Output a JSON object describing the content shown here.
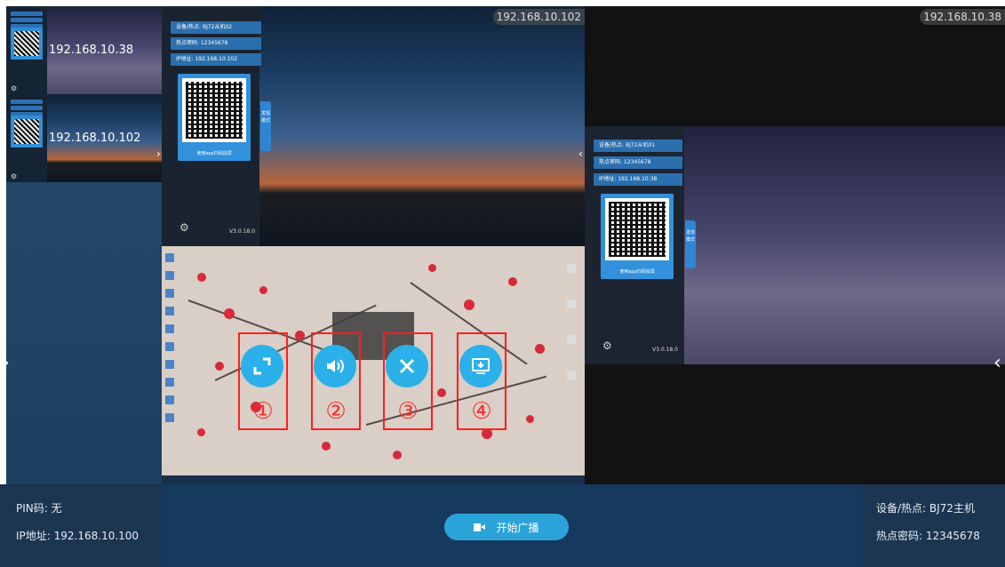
{
  "thumbnails": [
    {
      "ip": "192.168.10.38"
    },
    {
      "ip": "192.168.10.102"
    }
  ],
  "screen_102": {
    "ip": "192.168.10.102",
    "device": "设备/热点: BJ72从机02",
    "hotspot_password": "热点密码: 12345678",
    "ip_address": "IP地址: 192.168.10.102",
    "qr_caption": "使用app扫码投屏",
    "mode_tab": "发现模式",
    "version": "V3.0.18.0"
  },
  "screen_38": {
    "ip": "192.168.10.38",
    "device": "设备/热点: BJ72从机01",
    "hotspot_password": "热点密码: 12345678",
    "ip_address": "IP地址: 192.168.10.38",
    "qr_caption": "使用app扫码投屏",
    "mode_tab": "发现模式",
    "version": "V3.0.18.0"
  },
  "controls": [
    {
      "icon": "fullscreen-icon",
      "number": "①"
    },
    {
      "icon": "volume-icon",
      "number": "②"
    },
    {
      "icon": "close-icon",
      "number": "③"
    },
    {
      "icon": "download-screen-icon",
      "number": "④"
    }
  ],
  "colors": {
    "accent": "#2bb0ea",
    "highlight": "#ff1f1f",
    "bar": "#163a5e"
  },
  "footer": {
    "pin": "PIN码: 无",
    "ip": "IP地址: 192.168.10.100",
    "broadcast_label": "开始广播",
    "host": "设备/热点: BJ72主机",
    "password": "热点密码: 12345678"
  }
}
